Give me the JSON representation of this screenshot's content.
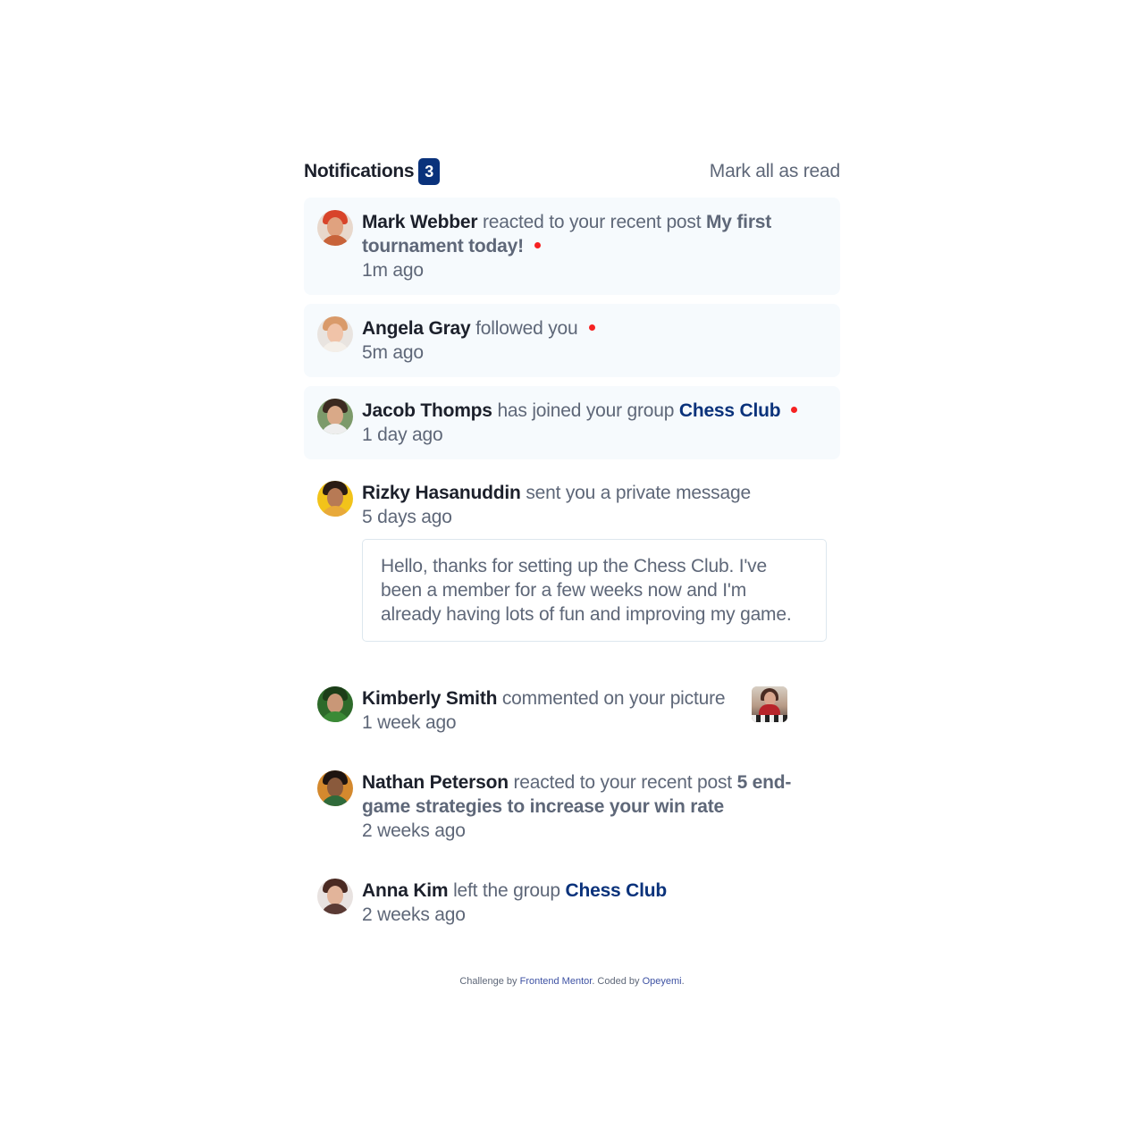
{
  "header": {
    "title": "Notifications",
    "unread_count": "3",
    "mark_all": "Mark all as read"
  },
  "notifications": [
    {
      "user": "Mark Webber",
      "action": "reacted to your recent post",
      "post": "My first tournament today!",
      "time": "1m ago",
      "unread": true,
      "avatar_icon": "avatar-mark-webber"
    },
    {
      "user": "Angela Gray",
      "action": "followed you",
      "time": "5m ago",
      "unread": true,
      "avatar_icon": "avatar-angela-gray"
    },
    {
      "user": "Jacob Thomps",
      "action": "has joined your group",
      "group": "Chess Club",
      "time": "1 day ago",
      "unread": true,
      "avatar_icon": "avatar-jacob-thomps"
    },
    {
      "user": "Rizky Hasanuddin",
      "action": "sent you a private message",
      "time": "5 days ago",
      "message": "Hello, thanks for setting up the Chess Club. I've been a member for a few weeks now and I'm already having lots of fun and improving my game.",
      "unread": false,
      "avatar_icon": "avatar-rizky-hasanuddin"
    },
    {
      "user": "Kimberly Smith",
      "action": "commented on your picture",
      "time": "1 week ago",
      "unread": false,
      "avatar_icon": "avatar-kimberly-smith",
      "picture_icon": "chess-picture-thumbnail"
    },
    {
      "user": "Nathan Peterson",
      "action": "reacted to your recent post",
      "post": "5 end-game strategies to increase your win rate",
      "time": "2 weeks ago",
      "unread": false,
      "avatar_icon": "avatar-nathan-peterson"
    },
    {
      "user": "Anna Kim",
      "action": "left the group",
      "group": "Chess Club",
      "time": "2 weeks ago",
      "unread": false,
      "avatar_icon": "avatar-anna-kim"
    }
  ],
  "footer": {
    "prefix": "Challenge by",
    "link1": "Frontend Mentor",
    "middle": ". Coded by",
    "link2": "Opeyemi",
    "suffix": "."
  },
  "colors": {
    "primary": "#0a327b",
    "red_dot": "#f62222",
    "unread_bg": "#f6fafd",
    "dark_text": "#1c202b",
    "grey_text": "#5e6778"
  }
}
